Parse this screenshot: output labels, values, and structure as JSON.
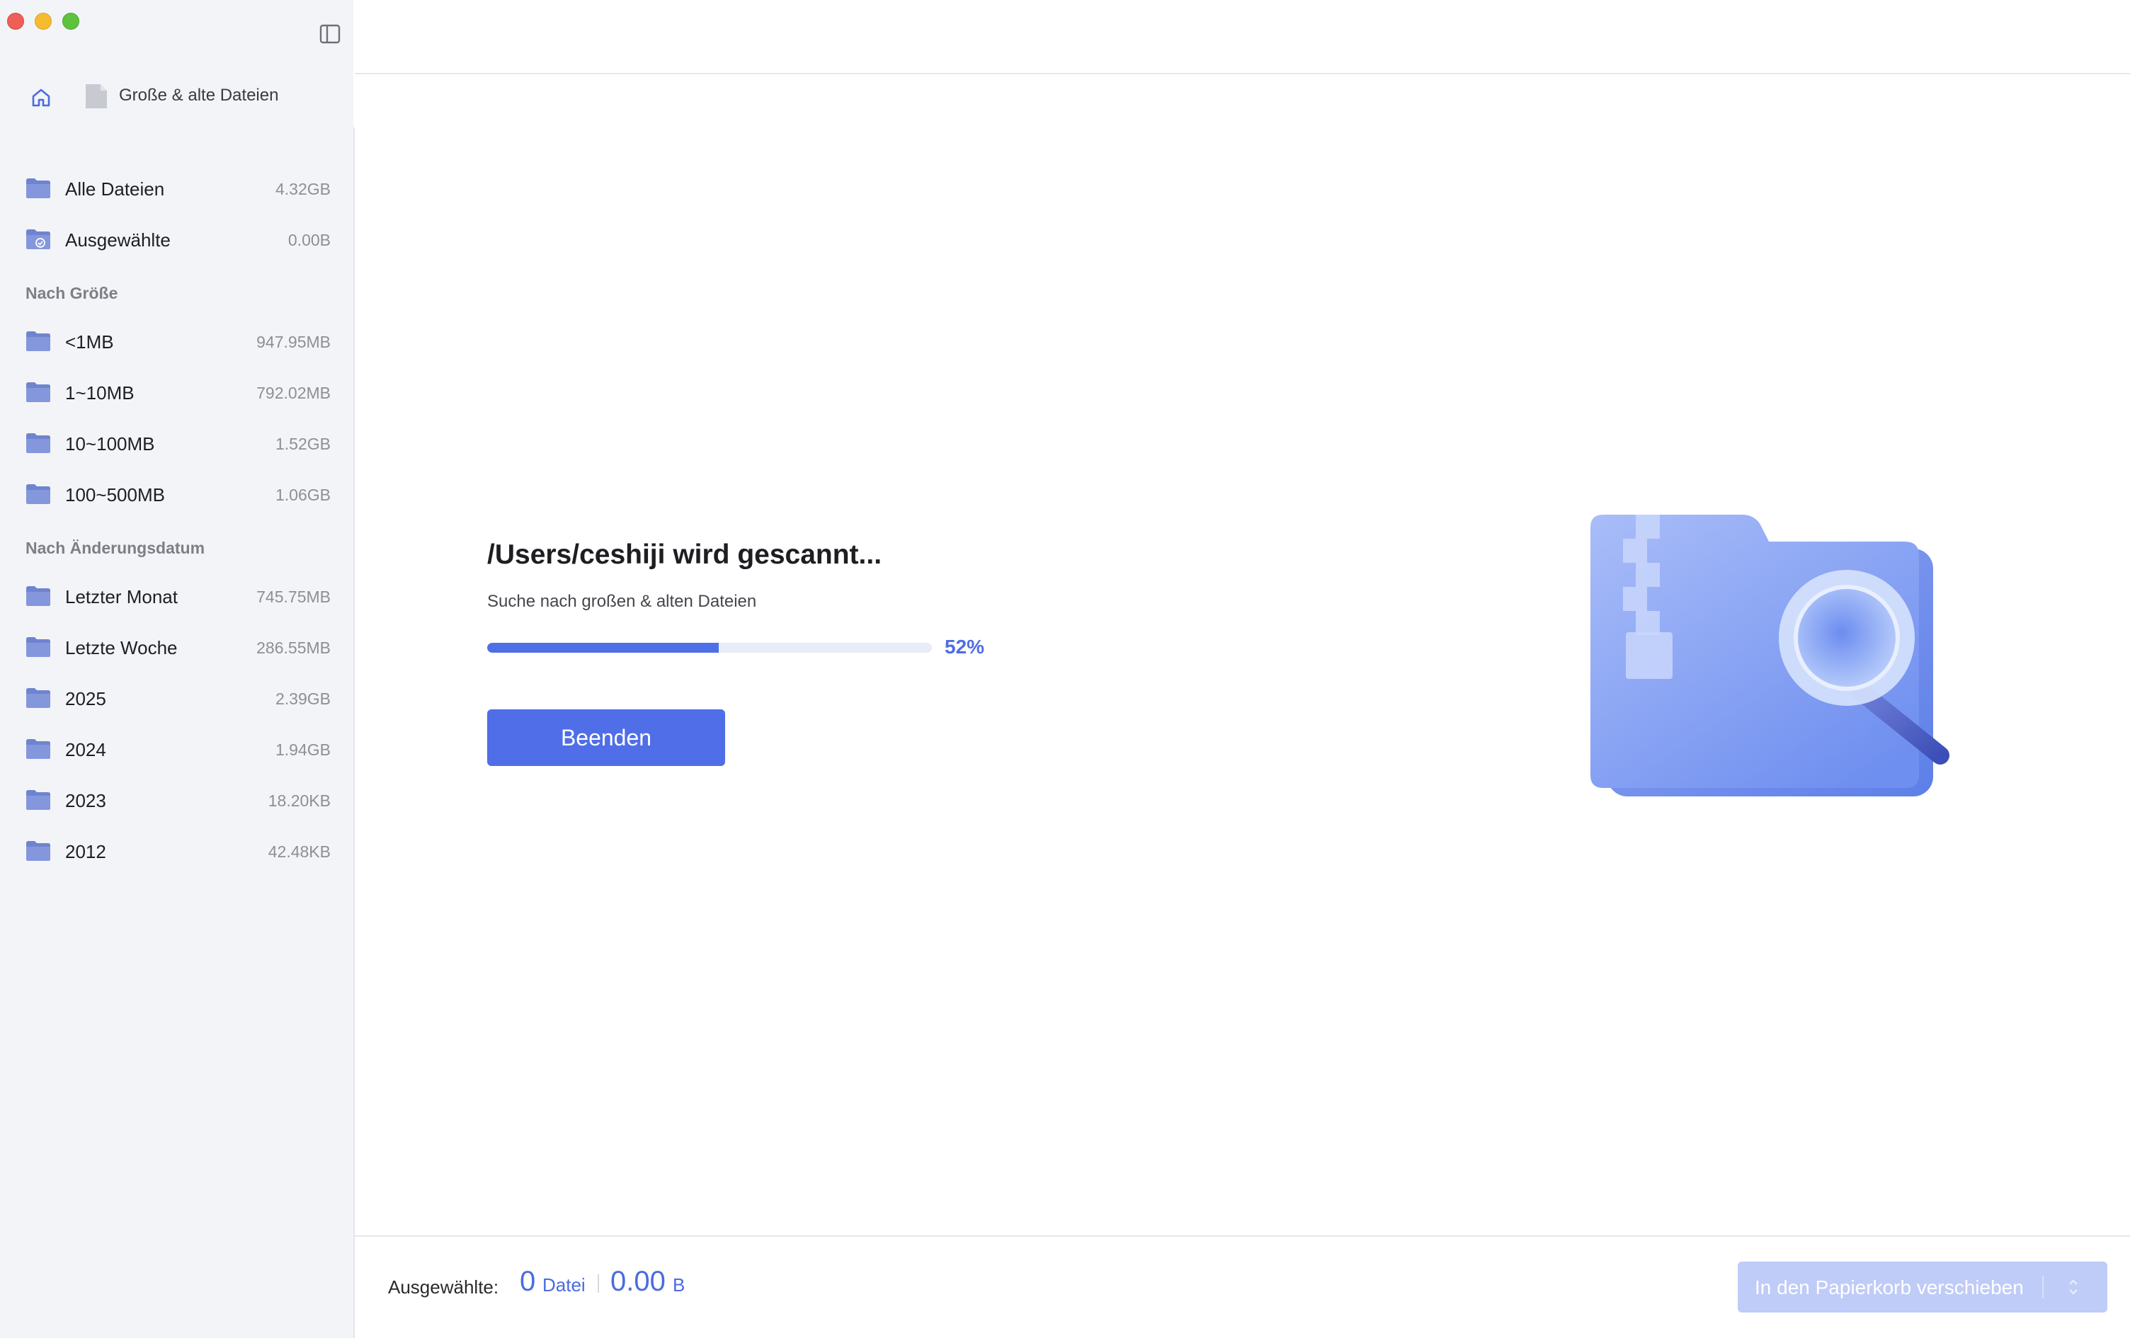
{
  "breadcrumb": {
    "current": "Große & alte Dateien"
  },
  "sidebar": {
    "top_items": [
      {
        "label": "Alle Dateien",
        "size": "4.32GB",
        "icon": "folder-icon"
      },
      {
        "label": "Ausgewählte",
        "size": "0.00B",
        "icon": "folder-check-icon"
      }
    ],
    "by_size": {
      "heading": "Nach Größe",
      "items": [
        {
          "label": "<1MB",
          "size": "947.95MB"
        },
        {
          "label": "1~10MB",
          "size": "792.02MB"
        },
        {
          "label": "10~100MB",
          "size": "1.52GB"
        },
        {
          "label": "100~500MB",
          "size": "1.06GB"
        }
      ]
    },
    "by_date": {
      "heading": "Nach Änderungsdatum",
      "items": [
        {
          "label": "Letzter Monat",
          "size": "745.75MB"
        },
        {
          "label": "Letzte Woche",
          "size": "286.55MB"
        },
        {
          "label": "2025",
          "size": "2.39GB"
        },
        {
          "label": "2024",
          "size": "1.94GB"
        },
        {
          "label": "2023",
          "size": "18.20KB"
        },
        {
          "label": "2012",
          "size": "42.48KB"
        }
      ]
    }
  },
  "scan": {
    "title": "/Users/ceshiji wird gescannt...",
    "subtitle": "Suche nach großen & alten Dateien",
    "progress": 52,
    "progress_label": "52%",
    "stop_label": "Beenden"
  },
  "footer": {
    "selected_label": "Ausgewählte:",
    "count": "0",
    "count_unit": "Datei",
    "size": "0.00",
    "size_unit": "B",
    "trash_label": "In den Papierkorb verschieben"
  },
  "colors": {
    "accent": "#4f6ee8",
    "folder": "#7b8fd6",
    "sidebar_bg": "#f3f4f7",
    "disabled_button": "#bfccf7"
  }
}
